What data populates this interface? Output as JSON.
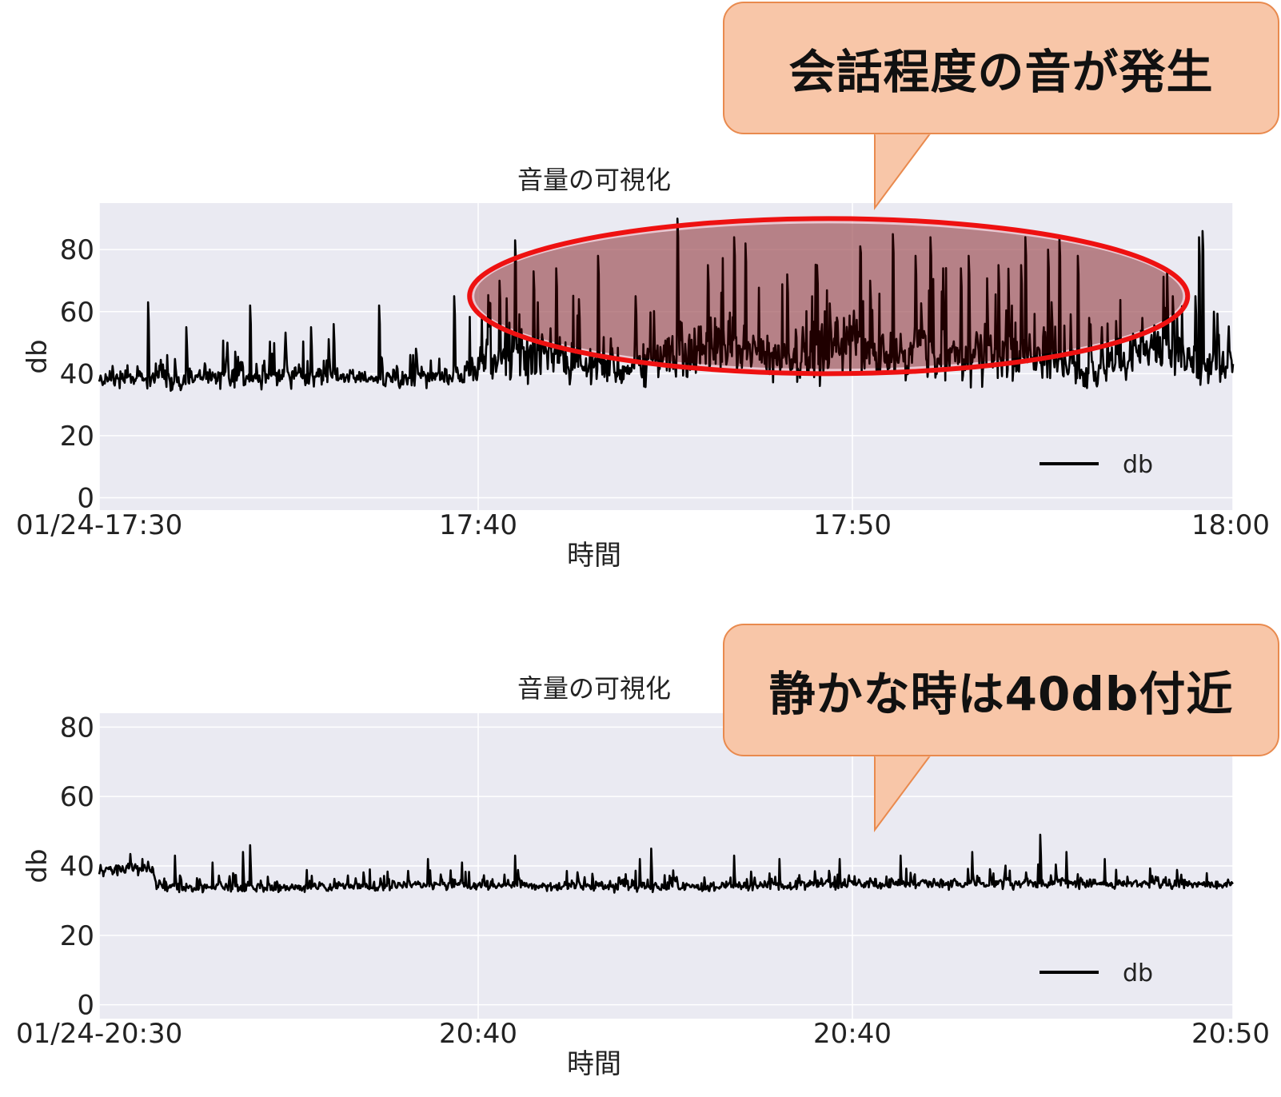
{
  "callouts": [
    {
      "text": "会話程度の音が発生"
    },
    {
      "text": "静かな時は40db付近"
    }
  ],
  "chart_data": [
    {
      "type": "line",
      "title": "音量の可視化",
      "xlabel": "時間",
      "ylabel": "db",
      "x_ticks": [
        "01/24-17:30",
        "17:40",
        "17:50",
        "18:00"
      ],
      "x_range": [
        "01/24-17:30",
        "18:00"
      ],
      "ylim": [
        -4,
        95
      ],
      "y_ticks": [
        0,
        20,
        40,
        60,
        80
      ],
      "grid": true,
      "legend": {
        "placement": "lower-right",
        "entries": [
          "db"
        ]
      },
      "series": [
        {
          "name": "db",
          "color": "#000000",
          "envelope": {
            "time_min": [
              0,
              1,
              2,
              3,
              4,
              5,
              6,
              7,
              8,
              9,
              10,
              11,
              12,
              13,
              14,
              15,
              16,
              17,
              18,
              19,
              20,
              21,
              22,
              23,
              24,
              25,
              26,
              27,
              28,
              29,
              30
            ],
            "low": [
              35,
              34,
              34,
              34,
              35,
              34,
              35,
              36,
              35,
              35,
              35,
              35,
              35,
              35,
              34,
              34,
              36,
              37,
              36,
              35,
              36,
              36,
              36,
              35,
              34,
              35,
              34,
              36,
              36,
              35,
              36
            ],
            "high": [
              46,
              50,
              47,
              52,
              48,
              55,
              52,
              46,
              47,
              50,
              62,
              75,
              70,
              62,
              60,
              85,
              80,
              75,
              70,
              82,
              83,
              80,
              75,
              78,
              80,
              70,
              60,
              65,
              80,
              62,
              58
            ]
          },
          "spikes": [
            [
              1.3,
              63
            ],
            [
              2.3,
              55
            ],
            [
              3.4,
              50
            ],
            [
              4.0,
              62
            ],
            [
              5.6,
              55
            ],
            [
              6.2,
              56
            ],
            [
              7.4,
              62
            ],
            [
              8.3,
              46
            ],
            [
              9.4,
              65
            ],
            [
              10.6,
              70
            ],
            [
              11.0,
              83
            ],
            [
              11.5,
              73
            ],
            [
              12.1,
              74
            ],
            [
              12.7,
              64
            ],
            [
              13.2,
              78
            ],
            [
              14.2,
              65
            ],
            [
              15.3,
              90
            ],
            [
              16.1,
              75
            ],
            [
              16.8,
              84
            ],
            [
              17.1,
              82
            ],
            [
              18.2,
              72
            ],
            [
              19.0,
              75
            ],
            [
              19.7,
              58
            ],
            [
              20.4,
              70
            ],
            [
              21.0,
              85
            ],
            [
              21.6,
              78
            ],
            [
              22.0,
              84
            ],
            [
              22.8,
              74
            ],
            [
              23.0,
              78
            ],
            [
              23.8,
              75
            ],
            [
              24.4,
              75
            ],
            [
              24.5,
              84
            ],
            [
              25.1,
              80
            ],
            [
              25.4,
              84
            ],
            [
              25.9,
              78
            ],
            [
              26.2,
              58
            ],
            [
              26.9,
              57
            ],
            [
              27.6,
              58
            ],
            [
              28.4,
              65
            ],
            [
              29.0,
              65
            ],
            [
              29.1,
              84
            ],
            [
              29.2,
              86
            ],
            [
              29.5,
              60
            ]
          ]
        }
      ],
      "annotations": [
        {
          "type": "ellipse",
          "color": "#ee1111",
          "fill": "#e8a8b4",
          "x_min": [
            9.8,
            28.8
          ],
          "y": [
            40,
            90
          ]
        }
      ]
    },
    {
      "type": "line",
      "title": "音量の可視化",
      "xlabel": "時間",
      "ylabel": "db",
      "x_ticks": [
        "01/24-20:30",
        "20:40",
        "20:40",
        "20:50"
      ],
      "x_range": [
        "01/24-20:30",
        "20:50"
      ],
      "ylim": [
        -4,
        84
      ],
      "y_ticks": [
        0,
        20,
        40,
        60,
        80
      ],
      "grid": true,
      "legend": {
        "placement": "lower-right",
        "entries": [
          "db"
        ]
      },
      "series": [
        {
          "name": "db",
          "color": "#000000",
          "envelope": {
            "time_min": [
              0,
              1,
              1.4,
              1.5,
              2,
              5,
              10,
              15,
              20,
              25,
              30
            ],
            "low": [
              37,
              37,
              37,
              33,
              32,
              32,
              33,
              32,
              33,
              33,
              33
            ],
            "high": [
              44,
              45,
              44,
              40,
              38,
              39,
              39,
              39,
              40,
              41,
              38
            ]
          },
          "spikes": [
            [
              2.0,
              43
            ],
            [
              3.0,
              41
            ],
            [
              3.8,
              44
            ],
            [
              4.0,
              46
            ],
            [
              8.7,
              42
            ],
            [
              9.6,
              41
            ],
            [
              11.0,
              43
            ],
            [
              14.3,
              42
            ],
            [
              14.6,
              45
            ],
            [
              16.8,
              43
            ],
            [
              18.0,
              42
            ],
            [
              19.6,
              42
            ],
            [
              21.2,
              43
            ],
            [
              23.1,
              44
            ],
            [
              24.9,
              49
            ],
            [
              25.6,
              44
            ],
            [
              26.6,
              42
            ]
          ]
        }
      ]
    }
  ]
}
